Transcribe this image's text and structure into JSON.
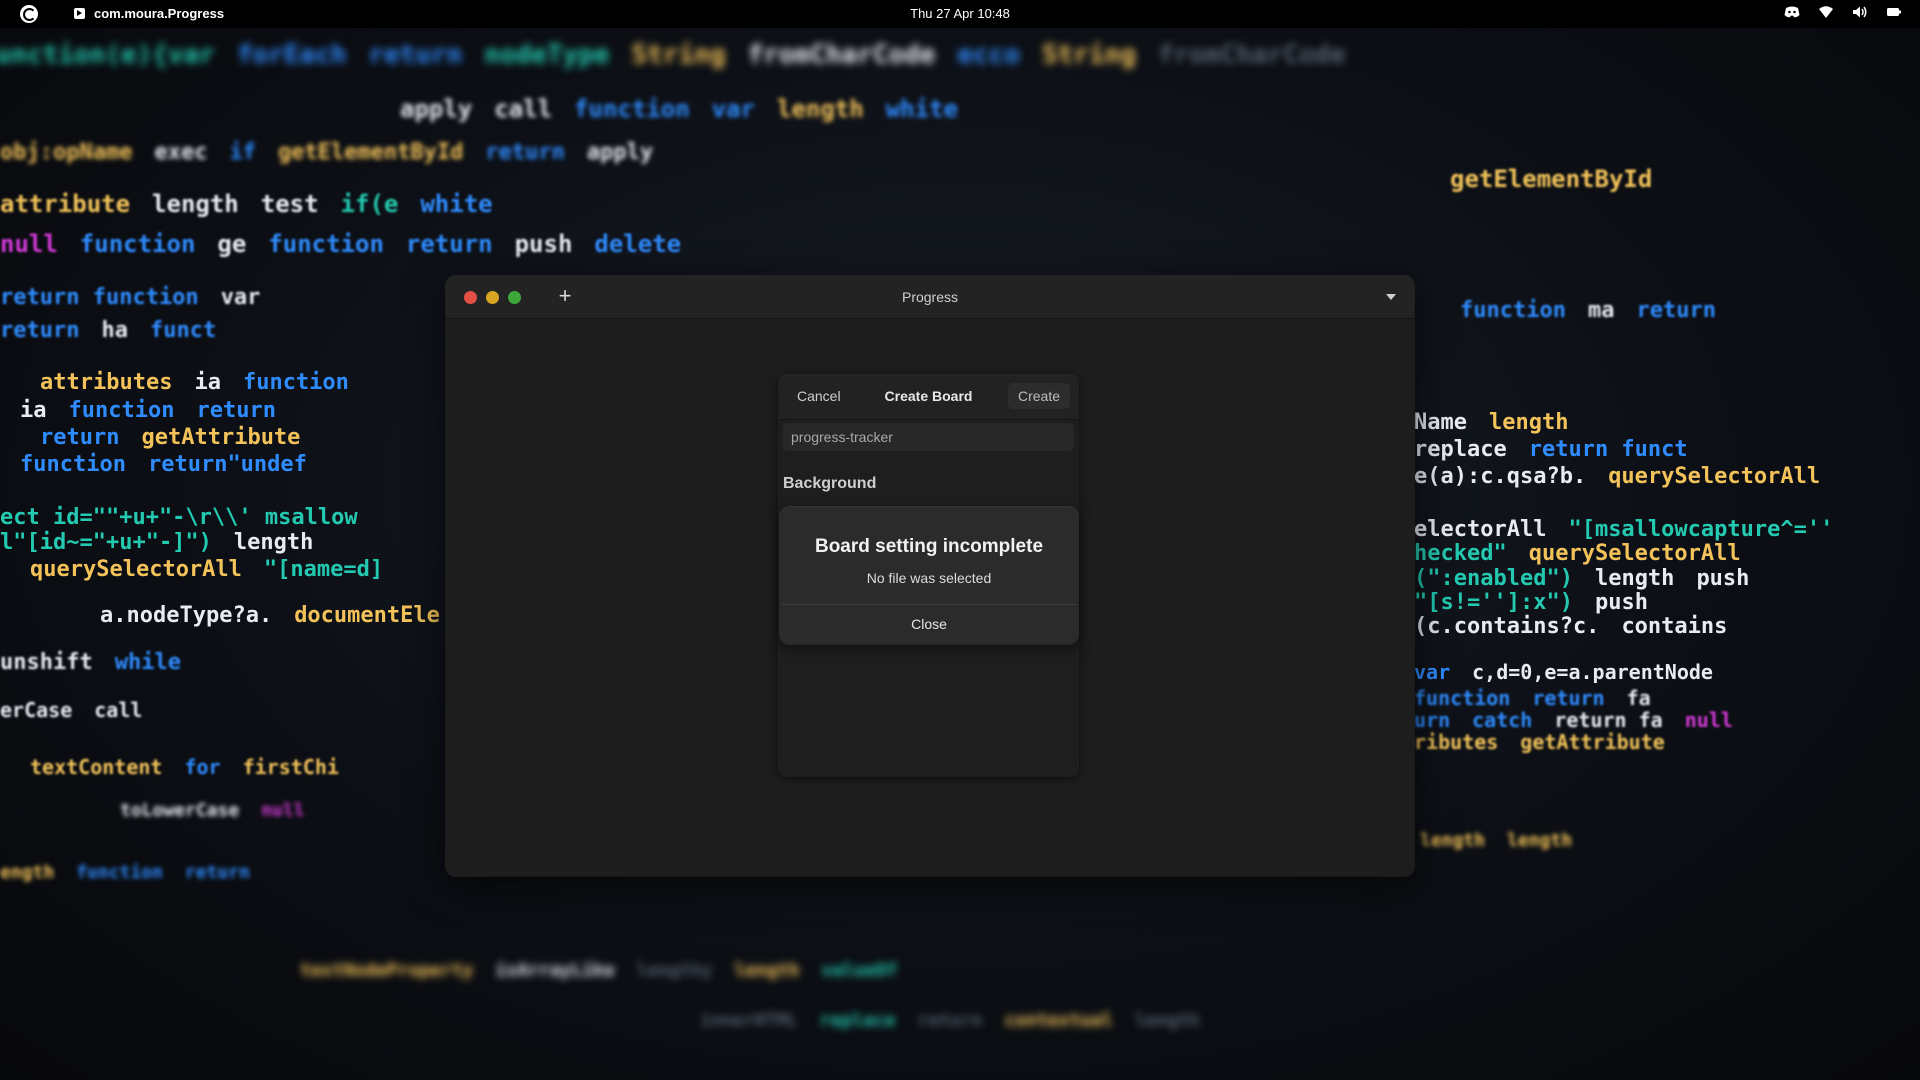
{
  "topbar": {
    "app_name": "com.moura.Progress",
    "clock": "Thu 27 Apr  10:48",
    "tray_icons": [
      "discord-icon",
      "wifi-icon",
      "volume-icon",
      "battery-icon"
    ]
  },
  "window": {
    "title": "Progress",
    "add_label": "+",
    "colors": {
      "close": "#e54f45",
      "minimize": "#d9a520",
      "maximize": "#3fa63a"
    }
  },
  "create_board": {
    "cancel_label": "Cancel",
    "title": "Create Board",
    "create_label": "Create",
    "name_value": "progress-tracker",
    "background_label": "Background"
  },
  "alert": {
    "title": "Board setting incomplete",
    "message": "No file was selected",
    "close_label": "Close"
  }
}
